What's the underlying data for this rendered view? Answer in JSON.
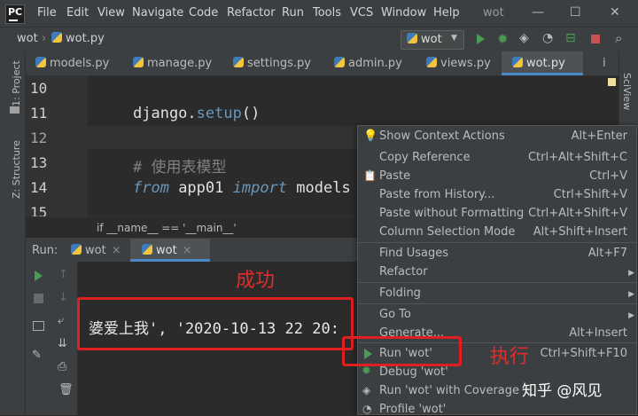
{
  "menubar": {
    "items": [
      "File",
      "Edit",
      "View",
      "Navigate",
      "Code",
      "Refactor",
      "Run",
      "Tools",
      "VCS",
      "Window",
      "Help"
    ],
    "window_title": "wot"
  },
  "navbar": {
    "project": "wot",
    "file": "wot.py",
    "run_config": "wot"
  },
  "tool_strips": {
    "project": "1: Project",
    "structure": "Z: Structure",
    "sciview": "SciView"
  },
  "tabs": [
    {
      "label": "models.py"
    },
    {
      "label": "manage.py"
    },
    {
      "label": "settings.py"
    },
    {
      "label": "admin.py"
    },
    {
      "label": "views.py"
    },
    {
      "label": "wot.py",
      "active": true
    }
  ],
  "tabs_overflow": "i",
  "editor": {
    "lines": [
      {
        "num": "10",
        "text": ""
      },
      {
        "num": "11",
        "text": "django.setup()"
      },
      {
        "num": "12",
        "text": ""
      },
      {
        "num": "13",
        "text": "# 使用表模型"
      },
      {
        "num": "14",
        "text": "from app01 import models"
      },
      {
        "num": "15",
        "text": ""
      }
    ],
    "breadcrumb": "if __name__ == '__main__'"
  },
  "run_panel": {
    "label": "Run:",
    "tabs": [
      "wot",
      "wot"
    ],
    "output": "婆爱上我', '2020-10-13 22 20:"
  },
  "annotations": {
    "success": "成功",
    "execute": "执行"
  },
  "context_menu": {
    "items": [
      {
        "label": "Show Context Actions",
        "shortcut": "Alt+Enter"
      },
      {
        "label": "Copy Reference",
        "shortcut": "Ctrl+Alt+Shift+C"
      },
      {
        "label": "Paste",
        "shortcut": "Ctrl+V"
      },
      {
        "label": "Paste from History...",
        "shortcut": "Ctrl+Shift+V"
      },
      {
        "label": "Paste without Formatting",
        "shortcut": "Ctrl+Alt+Shift+V"
      },
      {
        "label": "Column Selection Mode",
        "shortcut": "Alt+Shift+Insert"
      },
      {
        "label": "Find Usages",
        "shortcut": "Alt+F7"
      },
      {
        "label": "Refactor",
        "shortcut": ""
      },
      {
        "label": "Folding",
        "shortcut": ""
      },
      {
        "label": "Go To",
        "shortcut": ""
      },
      {
        "label": "Generate...",
        "shortcut": "Alt+Insert"
      },
      {
        "label": "Run 'wot'",
        "shortcut": "Ctrl+Shift+F10"
      },
      {
        "label": "Debug 'wot'",
        "shortcut": ""
      },
      {
        "label": "Run 'wot' with Coverage",
        "shortcut": ""
      },
      {
        "label": "Profile 'wot'",
        "shortcut": ""
      }
    ]
  },
  "watermark": "知乎 @风见",
  "colors": {
    "accent_blue": "#4a88c7",
    "run_green": "#499c54",
    "annotation_red": "#e02020",
    "keyword": "#6897bb"
  }
}
